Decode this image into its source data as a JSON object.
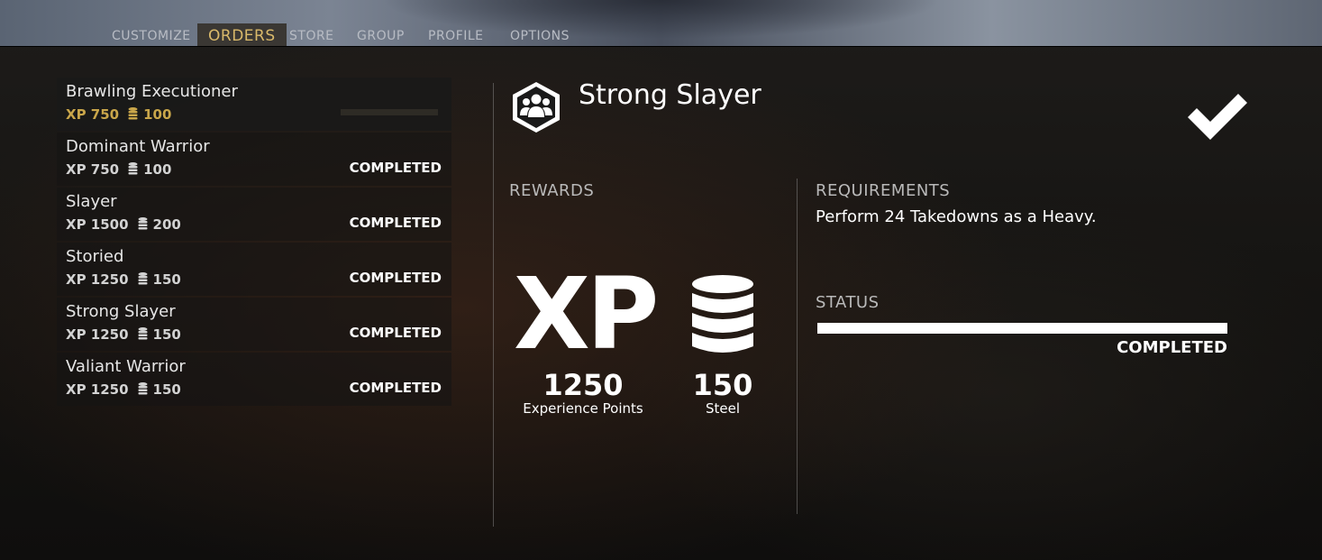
{
  "nav": {
    "tabs": [
      {
        "label": "CUSTOMIZE"
      },
      {
        "label": "ORDERS"
      },
      {
        "label": "STORE"
      },
      {
        "label": "GROUP"
      },
      {
        "label": "PROFILE"
      },
      {
        "label": "OPTIONS"
      }
    ],
    "active_tab": "ORDERS"
  },
  "orders": [
    {
      "name": "Brawling Executioner",
      "xp": "XP 750",
      "steel": "100",
      "status": ""
    },
    {
      "name": "Dominant Warrior",
      "xp": "XP 750",
      "steel": "100",
      "status": "COMPLETED"
    },
    {
      "name": "Slayer",
      "xp": "XP 1500",
      "steel": "200",
      "status": "COMPLETED"
    },
    {
      "name": "Storied",
      "xp": "XP 1250",
      "steel": "150",
      "status": "COMPLETED"
    },
    {
      "name": "Strong Slayer",
      "xp": "XP 1250",
      "steel": "150",
      "status": "COMPLETED"
    },
    {
      "name": "Valiant Warrior",
      "xp": "XP 1250",
      "steel": "150",
      "status": "COMPLETED"
    }
  ],
  "detail": {
    "title": "Strong Slayer",
    "icon": "group-icon",
    "check_icon": "checkmark-icon",
    "rewards_label": "REWARDS",
    "xp_big": "XP",
    "xp_value": "1250",
    "xp_label": "Experience Points",
    "steel_value": "150",
    "steel_label": "Steel",
    "requirements_label": "REQUIREMENTS",
    "requirements_text": "Perform 24 Takedowns as a Heavy.",
    "status_label": "STATUS",
    "status_progress": 1.0,
    "status_text": "COMPLETED"
  },
  "colors": {
    "accent_gold": "#c9a64a",
    "active_tab": "#d9b96a"
  }
}
